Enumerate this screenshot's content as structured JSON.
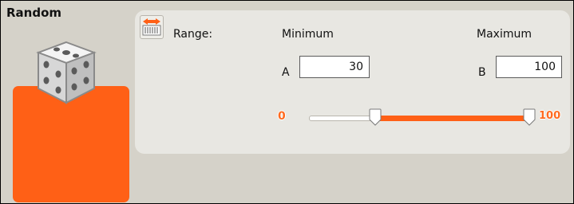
{
  "block": {
    "title": "Random",
    "accent_color": "#ff6016",
    "icon": "dice-icon"
  },
  "panel": {
    "range_icon": "range-icon",
    "range_label": "Range:",
    "minimum_label": "Minimum",
    "maximum_label": "Maximum",
    "a_label": "A",
    "b_label": "B",
    "a_value": "30",
    "b_value": "100"
  },
  "slider": {
    "min_label": "0",
    "max_label": "100",
    "scale_min": 0,
    "scale_max": 100,
    "low_value": 30,
    "high_value": 100,
    "fill_color": "#ff6016"
  }
}
